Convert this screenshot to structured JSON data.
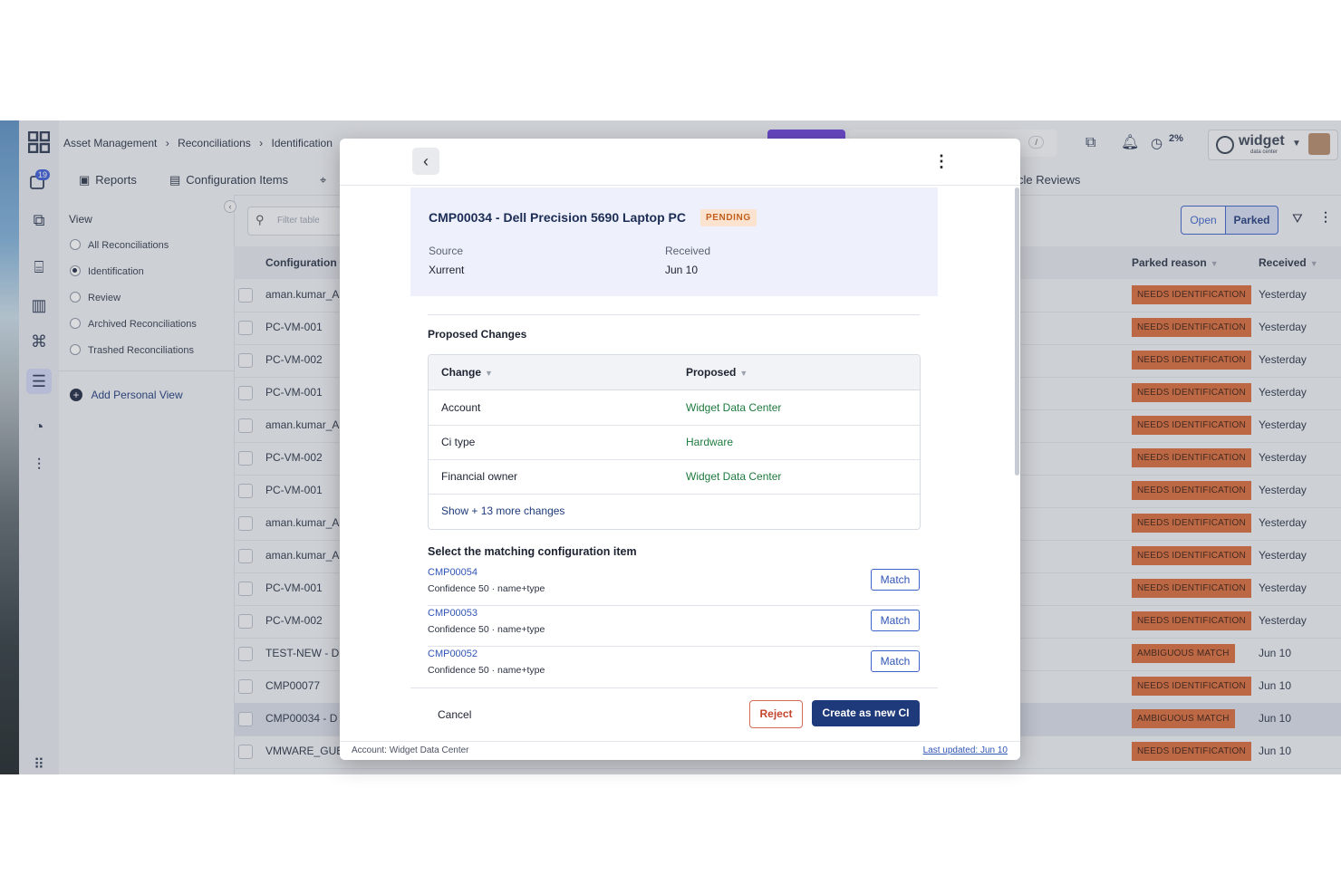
{
  "app": {
    "notification_count": "19",
    "breadcrumb": [
      "Asset Management",
      "Reconciliations",
      "Identification"
    ],
    "search_shortcut": "/",
    "usage_percent": "2%",
    "org_logo_text": "widget",
    "org_logo_sub": "data center"
  },
  "tabs": {
    "reports": "Reports",
    "configuration_items": "Configuration Items",
    "lifecycle_reviews": "cle Reviews"
  },
  "sidebar": {
    "view_label": "View",
    "options": [
      "All Reconciliations",
      "Identification",
      "Review",
      "Archived Reconciliations",
      "Trashed Reconciliations"
    ],
    "selected": "Identification",
    "add_view": "Add Personal View"
  },
  "toolbar": {
    "filter_placeholder": "Filter table",
    "toggle_open": "Open",
    "toggle_parked": "Parked"
  },
  "table": {
    "col_configuration": "Configuration",
    "col_parked_reason": "Parked reason",
    "col_received": "Received",
    "rows": [
      {
        "name": "aman.kumar_A",
        "reason": "NEEDS IDENTIFICATION",
        "received": "Yesterday"
      },
      {
        "name": "PC-VM-001",
        "reason": "NEEDS IDENTIFICATION",
        "received": "Yesterday"
      },
      {
        "name": "PC-VM-002",
        "reason": "NEEDS IDENTIFICATION",
        "received": "Yesterday"
      },
      {
        "name": "PC-VM-001",
        "reason": "NEEDS IDENTIFICATION",
        "received": "Yesterday"
      },
      {
        "name": "aman.kumar_A",
        "reason": "NEEDS IDENTIFICATION",
        "received": "Yesterday"
      },
      {
        "name": "PC-VM-002",
        "reason": "NEEDS IDENTIFICATION",
        "received": "Yesterday"
      },
      {
        "name": "PC-VM-001",
        "reason": "NEEDS IDENTIFICATION",
        "received": "Yesterday"
      },
      {
        "name": "aman.kumar_A",
        "reason": "NEEDS IDENTIFICATION",
        "received": "Yesterday"
      },
      {
        "name": "aman.kumar_A",
        "reason": "NEEDS IDENTIFICATION",
        "received": "Yesterday"
      },
      {
        "name": "PC-VM-001",
        "reason": "NEEDS IDENTIFICATION",
        "received": "Yesterday"
      },
      {
        "name": "PC-VM-002",
        "reason": "NEEDS IDENTIFICATION",
        "received": "Yesterday"
      },
      {
        "name": "TEST-NEW - D",
        "reason": "AMBIGUOUS MATCH",
        "received": "Jun 10"
      },
      {
        "name": "CMP00077",
        "reason": "NEEDS IDENTIFICATION",
        "received": "Jun 10"
      },
      {
        "name": "CMP00034 - D",
        "reason": "AMBIGUOUS MATCH",
        "received": "Jun 10",
        "selected": true
      },
      {
        "name": "VMWARE_GUES",
        "reason": "NEEDS IDENTIFICATION",
        "received": "Jun 10"
      }
    ]
  },
  "modal": {
    "title": "CMP00034 - Dell Precision 5690 Laptop PC",
    "status": "PENDING",
    "source_label": "Source",
    "source_value": "Xurrent",
    "received_label": "Received",
    "received_value": "Jun 10",
    "proposed_heading": "Proposed Changes",
    "col_change": "Change",
    "col_proposed": "Proposed",
    "changes": [
      {
        "field": "Account",
        "value": "Widget Data Center"
      },
      {
        "field": "Ci type",
        "value": "Hardware"
      },
      {
        "field": "Financial owner",
        "value": "Widget Data Center"
      }
    ],
    "show_more": "Show + 13 more changes",
    "match_heading": "Select the matching configuration item",
    "candidates": [
      {
        "id": "CMP00054",
        "confidence": "Confidence 50 · name+type",
        "action": "Match"
      },
      {
        "id": "CMP00053",
        "confidence": "Confidence 50 · name+type",
        "action": "Match"
      },
      {
        "id": "CMP00052",
        "confidence": "Confidence 50 · name+type",
        "action": "Match"
      }
    ],
    "cancel": "Cancel",
    "reject": "Reject",
    "create": "Create as new CI",
    "account_footer": "Account: Widget Data Center",
    "last_updated": "Last updated: Jun 10"
  }
}
